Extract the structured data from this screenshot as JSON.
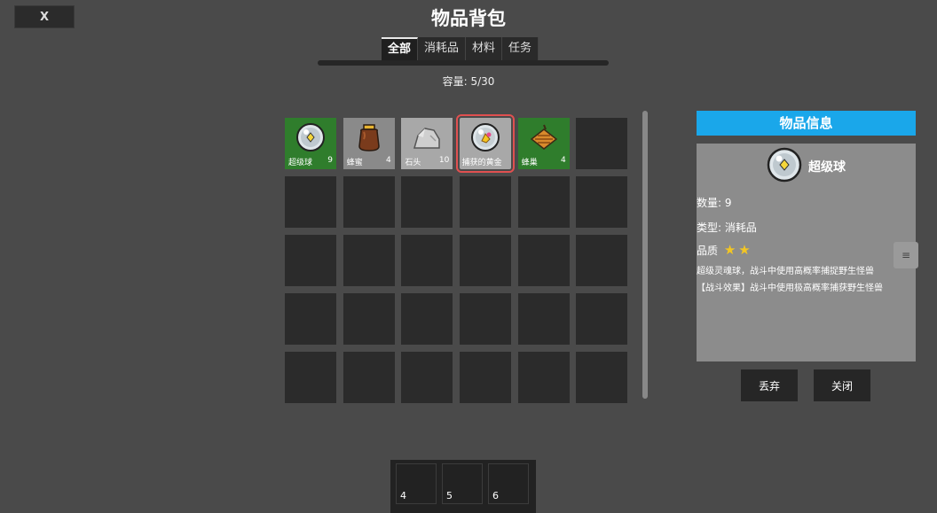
{
  "window": {
    "close_label": "X",
    "title": "物品背包",
    "capacity": "容量: 5/30"
  },
  "tabs": [
    {
      "label": "全部",
      "active": true
    },
    {
      "label": "消耗品",
      "active": false
    },
    {
      "label": "材料",
      "active": false
    },
    {
      "label": "任务",
      "active": false
    }
  ],
  "inventory": {
    "items": [
      {
        "name": "超级球",
        "count": "9",
        "icon": "super-ball-icon"
      },
      {
        "name": "蜂蜜",
        "count": "4",
        "icon": "honey-jar-icon"
      },
      {
        "name": "石头",
        "count": "10",
        "icon": "rock-icon"
      },
      {
        "name": "捕获的黄金",
        "count": "",
        "icon": "captured-gold-ball-icon"
      },
      {
        "name": "蜂巢",
        "count": "4",
        "icon": "honeycomb-icon"
      }
    ]
  },
  "info_panel": {
    "header": "物品信息",
    "name": "超级球",
    "quantity": "数量: 9",
    "type": "类型: 消耗品",
    "quality_label": "品质",
    "quality_stars": 2,
    "desc_1": "超级灵魂球，战斗中使用高概率捕捉野生怪兽",
    "desc_2": "【战斗效果】战斗中使用极高概率捕获野生怪兽",
    "side_handle": "≡"
  },
  "buttons": {
    "discard": "丢弃",
    "close": "关闭"
  },
  "hotbar": {
    "slots": [
      "4",
      "5",
      "6"
    ]
  },
  "colors": {
    "background": "#4a4a4a",
    "info_header": "#1aa7ea",
    "selected_outline": "#e05050",
    "slot_green": "#2f7d2c"
  }
}
